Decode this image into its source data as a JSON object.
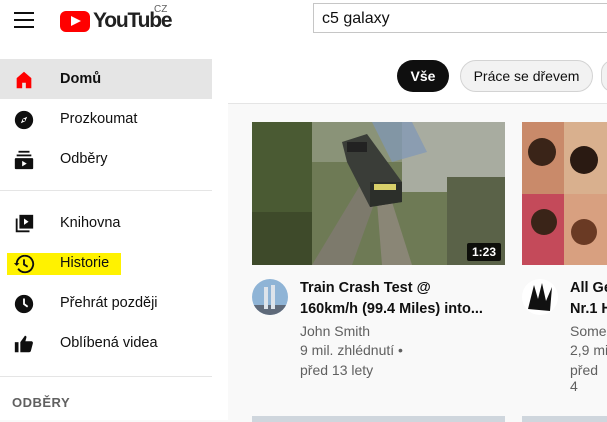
{
  "header": {
    "logo_text": "YouTube",
    "region": "CZ",
    "search_value": "c5 galaxy"
  },
  "sidebar": {
    "items": [
      {
        "label": "Domů",
        "icon": "home-icon",
        "active": true
      },
      {
        "label": "Prozkoumat",
        "icon": "compass-icon"
      },
      {
        "label": "Odběry",
        "icon": "subscriptions-icon"
      },
      {
        "label": "Knihovna",
        "icon": "library-icon"
      },
      {
        "label": "Historie",
        "icon": "history-icon",
        "highlighted": true
      },
      {
        "label": "Přehrát později",
        "icon": "clock-icon"
      },
      {
        "label": "Oblíbená videa",
        "icon": "thumbs-up-icon"
      }
    ],
    "section_title": "ODBĚRY"
  },
  "chips": [
    {
      "label": "Vše",
      "selected": true
    },
    {
      "label": "Práce se dřevem",
      "selected": false
    }
  ],
  "videos": [
    {
      "title_line1": "Train Crash Test @",
      "title_line2": "160km/h (99.4 Miles) into...",
      "channel": "John Smith",
      "views": "9 mil. zhlédnutí •",
      "age": "před 13 lety",
      "duration": "1:23"
    },
    {
      "title_line1": "All Ge",
      "title_line2": "Nr.1 H",
      "channel": "Some",
      "views": "2,9 mi",
      "age": "před 4"
    }
  ],
  "colors": {
    "brand_red": "#ff0000",
    "highlight": "#fff200",
    "active_nav": "#e5e5e5",
    "chip_selected": "#0f0f0f",
    "secondary_text": "#606060"
  }
}
